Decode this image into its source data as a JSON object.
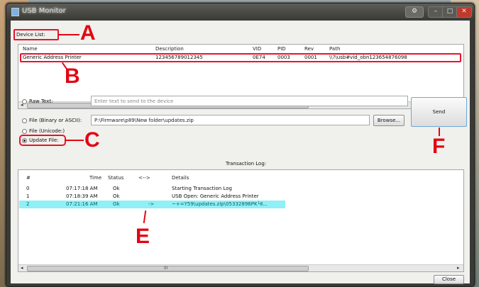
{
  "window": {
    "title": "USB Monitor"
  },
  "device_list": {
    "label": "Device List:",
    "columns": [
      "Name",
      "Description",
      "VID",
      "PID",
      "Rev",
      "Path"
    ],
    "rows": [
      {
        "name": "Generic Address Printer",
        "description": "123456789012345",
        "vid": "0E74",
        "pid": "0003",
        "rev": "0001",
        "path": "\\\\?\\usb#vid_obn123654876098"
      }
    ]
  },
  "send_options": {
    "raw_text": {
      "label": "Raw Text:",
      "placeholder": "Enter text to send to the device"
    },
    "file_binary": {
      "label": "File (Binary or ASCII):",
      "value": "P:\\Firmware\\p89\\New folder\\updates.zip"
    },
    "file_unicode": {
      "label": "File (Unicode:)"
    },
    "update_file": {
      "label": "Update File:"
    },
    "browse_label": "Browse...",
    "send_label": "Send"
  },
  "transaction_log": {
    "title": "Transaction Log:",
    "columns": [
      "#",
      "Time",
      "Status",
      "<-->",
      "Details"
    ],
    "rows": [
      {
        "num": "0",
        "time": "07:17:18 AM",
        "status": "Ok",
        "dir": "",
        "details": "Starting Transaction Log"
      },
      {
        "num": "1",
        "time": "07:18:39 AM",
        "status": "Ok",
        "dir": "",
        "details": "USB Open: Generic Address Printer"
      },
      {
        "num": "2",
        "time": "07:21:16 AM",
        "status": "Ok",
        "dir": "->",
        "details": "~+=Y59\\updates.zip\\05332896PK└Ⅱ..."
      }
    ]
  },
  "close_label": "Close",
  "scroll": {
    "grip": "III"
  },
  "annotations": {
    "a": "A",
    "b": "B",
    "c": "C",
    "e": "E",
    "f": "F"
  },
  "colors": {
    "annotation_red": "#e30613",
    "highlight_row": "#8ff0f5"
  }
}
